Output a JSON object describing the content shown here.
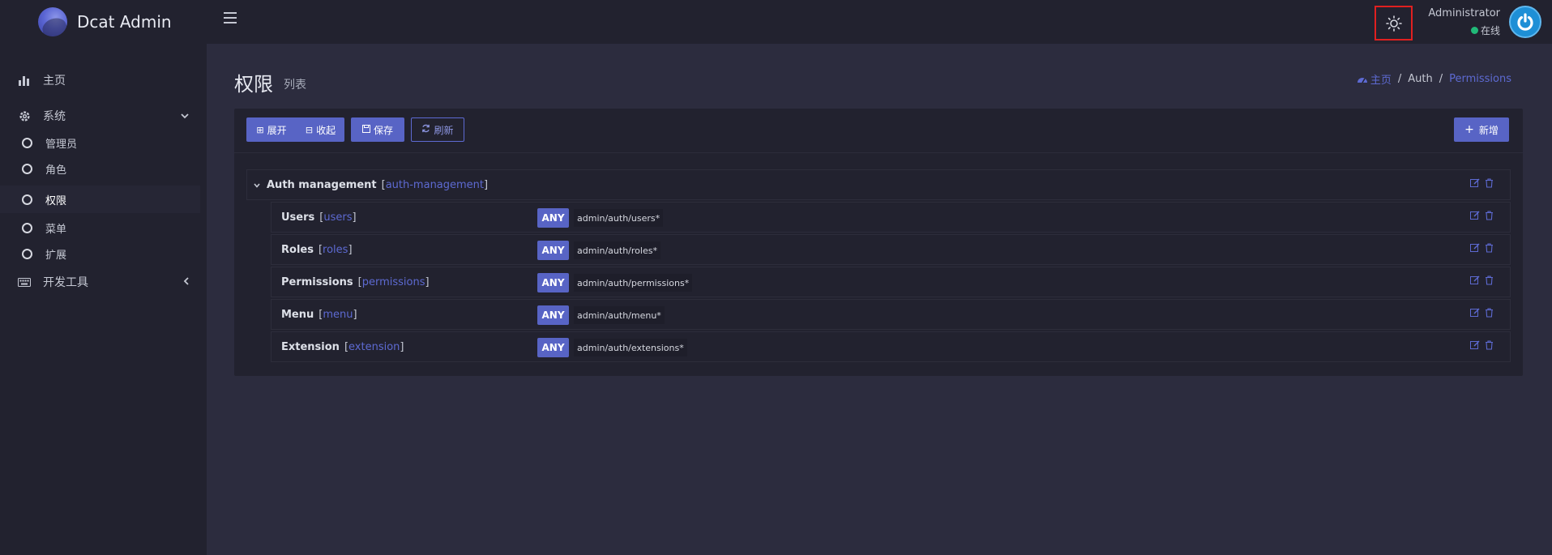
{
  "brand": {
    "name": "Dcat Admin"
  },
  "sidebar": {
    "items": [
      {
        "label": "主页",
        "icon": "bar-chart-icon"
      },
      {
        "label": "系统",
        "icon": "gear-icon",
        "expanded": true
      },
      {
        "label": "管理员"
      },
      {
        "label": "角色"
      },
      {
        "label": "权限",
        "active": true
      },
      {
        "label": "菜单"
      },
      {
        "label": "扩展"
      },
      {
        "label": "开发工具",
        "icon": "keyboard-icon"
      }
    ]
  },
  "header": {
    "user_name": "Administrator",
    "user_status": "在线"
  },
  "page": {
    "title": "权限",
    "subtitle": "列表"
  },
  "breadcrumb": {
    "home": "主页",
    "section": "Auth",
    "current": "Permissions"
  },
  "toolbar": {
    "expand_label": "展开",
    "collapse_label": "收起",
    "save_label": "保存",
    "refresh_label": "刷新",
    "new_label": "新增"
  },
  "tree": {
    "root": {
      "title": "Auth management",
      "slug": "auth-management"
    },
    "children": [
      {
        "title": "Users",
        "slug": "users",
        "method": "ANY",
        "path": "admin/auth/users*"
      },
      {
        "title": "Roles",
        "slug": "roles",
        "method": "ANY",
        "path": "admin/auth/roles*"
      },
      {
        "title": "Permissions",
        "slug": "permissions",
        "method": "ANY",
        "path": "admin/auth/permissions*"
      },
      {
        "title": "Menu",
        "slug": "menu",
        "method": "ANY",
        "path": "admin/auth/menu*"
      },
      {
        "title": "Extension",
        "slug": "extension",
        "method": "ANY",
        "path": "admin/auth/extensions*"
      }
    ]
  },
  "colors": {
    "accent": "#5864c5",
    "link": "#5d6ad2",
    "online": "#21b978",
    "highlight_border": "#e02020"
  }
}
